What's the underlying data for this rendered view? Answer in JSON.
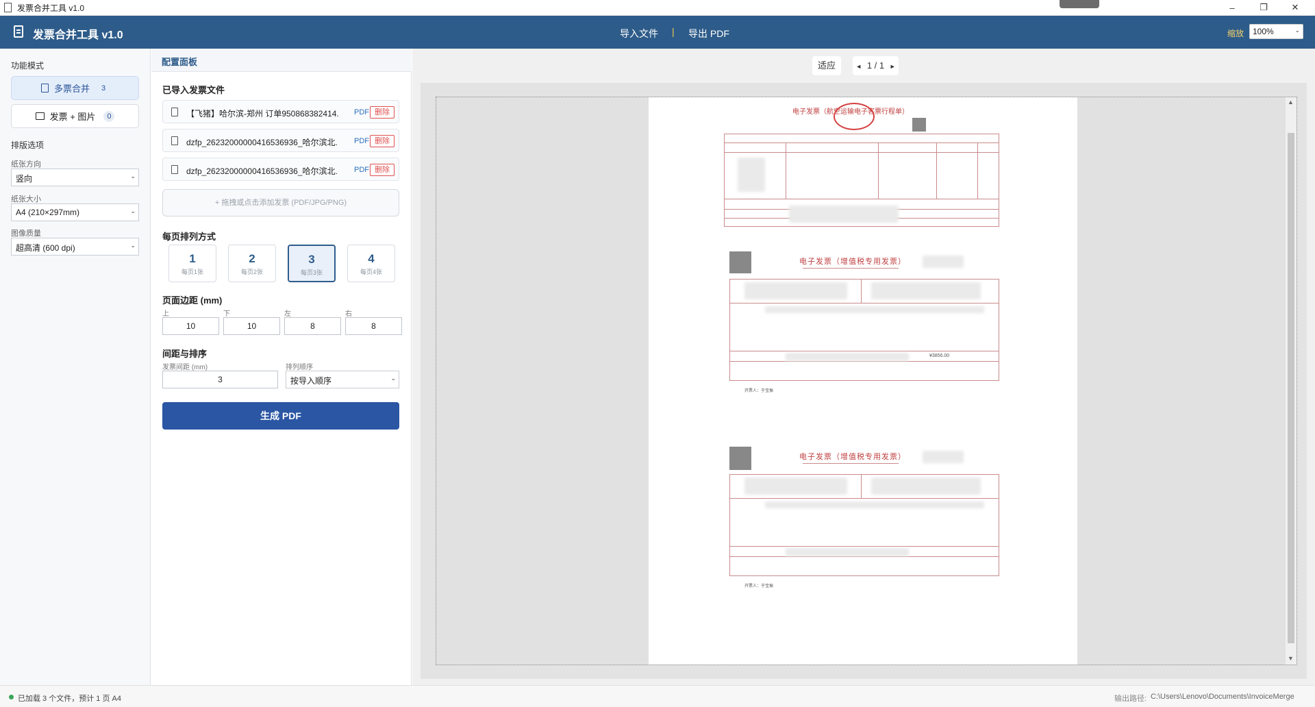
{
  "window": {
    "title": "发票合并工具 v1.0",
    "minimize": "–",
    "restore": "❐",
    "close": "✕"
  },
  "header": {
    "app_title": "发票合并工具 v1.0",
    "menu_import": "导入文件",
    "menu_separator": "|",
    "menu_export": "导出 PDF",
    "zoom_label": "缩放",
    "zoom_value": "100%"
  },
  "sidebar": {
    "mode_title": "功能模式",
    "modes": [
      {
        "label": "多票合并",
        "count": "3",
        "active": true
      },
      {
        "label": "发票 + 图片",
        "count": "0",
        "active": false
      }
    ],
    "layout_title": "排版选项",
    "orientation_label": "纸张方向",
    "orientation_value": "竖向",
    "paper_label": "纸张大小",
    "paper_value": "A4 (210×297mm)",
    "quality_label": "图像质量",
    "quality_value": "超高清 (600 dpi)"
  },
  "panel": {
    "head": "配置面板",
    "files_title": "已导入发票文件",
    "files": [
      {
        "name": "【飞猪】哈尔滨-郑州 订单950868382414...",
        "type": "PDF",
        "action": "删除"
      },
      {
        "name": "dzfp_26232000000416536936_哈尔滨北...",
        "type": "PDF",
        "action": "删除"
      },
      {
        "name": "dzfp_26232000000416536936_哈尔滨北...",
        "type": "PDF",
        "action": "删除"
      }
    ],
    "drop_hint": "+ 拖拽或点击添加发票 (PDF/JPG/PNG)",
    "per_page_title": "每页排列方式",
    "per_page_options": [
      {
        "num": "1",
        "sub": "每页1张",
        "active": false
      },
      {
        "num": "2",
        "sub": "每页2张",
        "active": false
      },
      {
        "num": "3",
        "sub": "每页3张",
        "active": true
      },
      {
        "num": "4",
        "sub": "每页4张",
        "active": false
      }
    ],
    "margin_title": "页面边距 (mm)",
    "margins": [
      {
        "label": "上",
        "value": "10"
      },
      {
        "label": "下",
        "value": "10"
      },
      {
        "label": "左",
        "value": "8"
      },
      {
        "label": "右",
        "value": "8"
      }
    ],
    "spacing_title": "间距与排序",
    "gap_label": "发票间距 (mm)",
    "gap_value": "3",
    "order_label": "排列顺序",
    "order_value": "按导入顺序",
    "generate_label": "生成 PDF"
  },
  "preview": {
    "fit_label": "适应",
    "page_prev": "◄",
    "page_indicator": "1 / 1",
    "page_next": "►",
    "invoice1_title": "电子发票（航空运输电子客票行程单）",
    "invoice2_title": "电子发票（增值税专用发票）",
    "invoice3_title": "电子发票（增值税专用发票）",
    "invoice2_amount": "¥3856.00",
    "drawer_label": "开票人：于宝振",
    "scroll_up": "▲",
    "scroll_down": "▼"
  },
  "status": {
    "text": "已加载 3 个文件，预计 1 页 A4",
    "path_label": "输出路径:",
    "path_value": "C:\\Users\\Lenovo\\Documents\\InvoiceMerge"
  },
  "colors": {
    "header_bg": "#2e5c8a",
    "primary_button": "#2a56a3",
    "delete_red": "#e05050",
    "invoice_red": "#c04040",
    "status_ok": "#3aa55a"
  }
}
